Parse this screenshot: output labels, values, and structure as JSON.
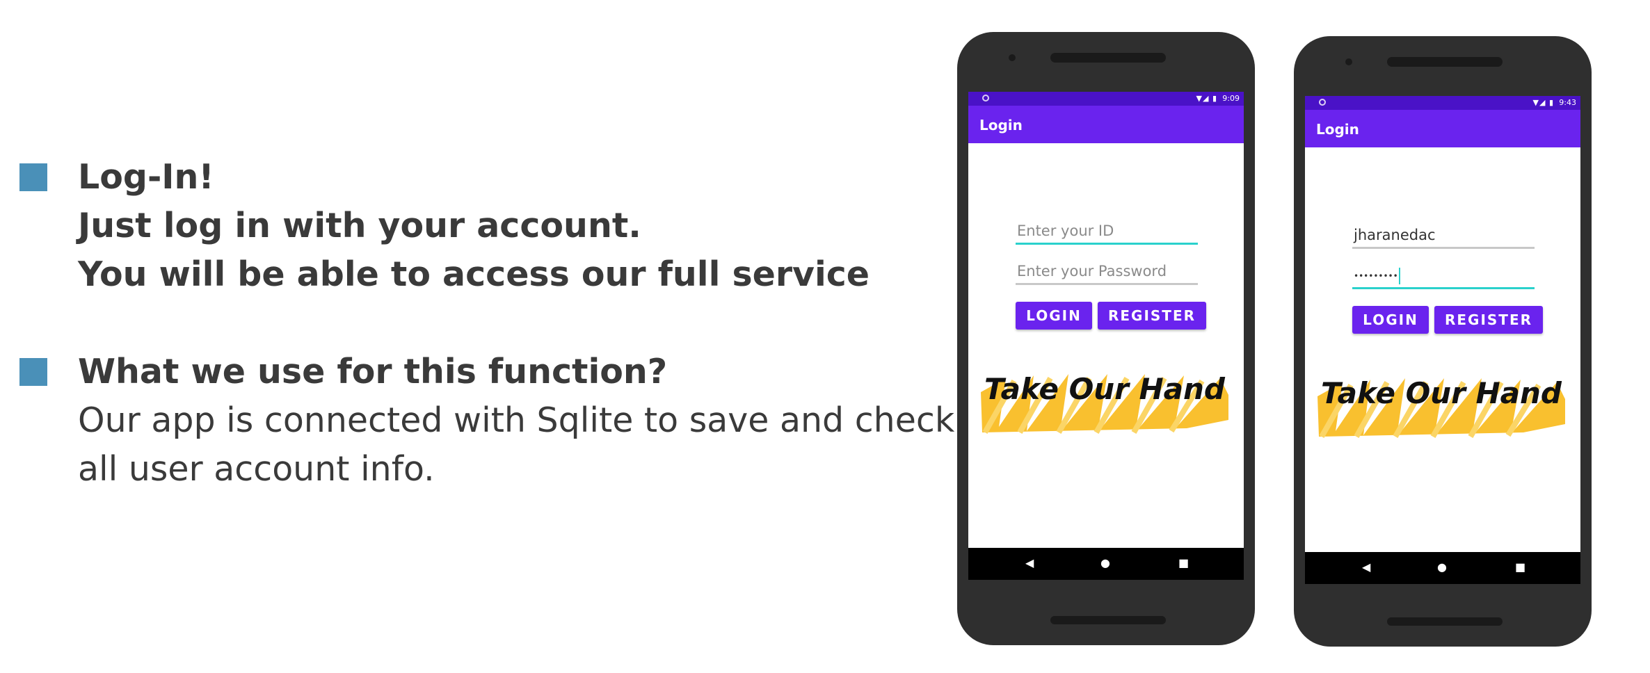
{
  "slide": {
    "bullets": [
      {
        "lines": [
          "Log-In!",
          "Just log in with your account.",
          "You will be able to access our full service"
        ]
      },
      {
        "heading": "What we use for this function?",
        "body_lines": [
          "Our app is connected with Sqlite to save and check",
          "all user account info."
        ]
      }
    ],
    "bullet_color": "#4a90b8"
  },
  "phones": [
    {
      "status_time": "9:09",
      "app_bar_title": "Login",
      "id_placeholder": "Enter your ID",
      "password_placeholder": "Enter your Password",
      "login_label": "LOGIN",
      "register_label": "REGISTER",
      "logo_text": "Take Our Hand"
    },
    {
      "status_time": "9:43",
      "app_bar_title": "Login",
      "id_value": "jharanedac",
      "password_mask": "•••••••••",
      "login_label": "LOGIN",
      "register_label": "REGISTER",
      "logo_text": "Take Our Hand"
    }
  ],
  "nav_icons": {
    "back": "◀",
    "home": "●",
    "recents": "■"
  },
  "status_icons": "▼◢ ▮",
  "colors": {
    "status_bar": "#4a12c7",
    "app_bar": "#6a23ee",
    "button": "#6a23ee",
    "accent_underline": "#2ad1cc",
    "logo_brush": "#f9c02f"
  }
}
